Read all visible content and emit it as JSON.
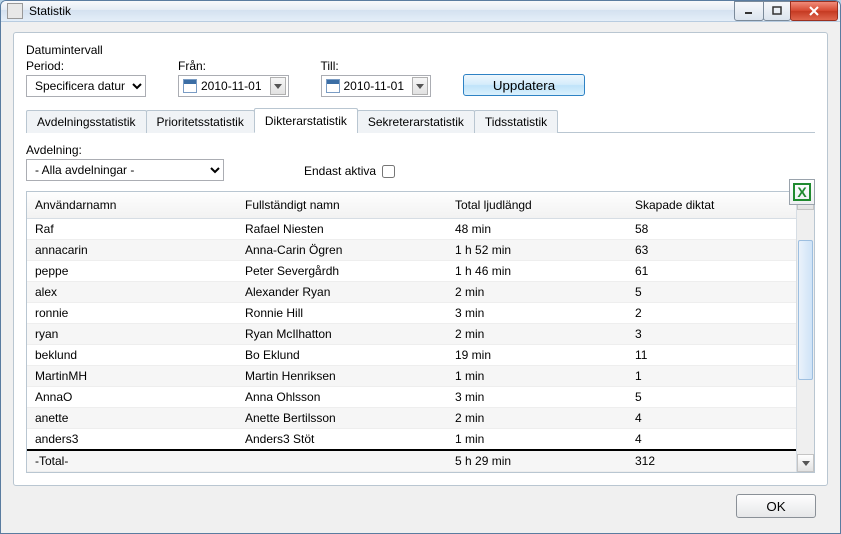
{
  "window": {
    "title": "Statistik"
  },
  "filters": {
    "section_label": "Datumintervall",
    "period_label": "Period:",
    "period_value": "Specificera datum",
    "from_label": "Från:",
    "from_value": "2010-11-01",
    "to_label": "Till:",
    "to_value": "2010-11-01",
    "update_label": "Uppdatera"
  },
  "tabs": [
    {
      "label": "Avdelningsstatistik",
      "active": false
    },
    {
      "label": "Prioritetsstatistik",
      "active": false
    },
    {
      "label": "Dikterarstatistik",
      "active": true
    },
    {
      "label": "Sekreterarstatistik",
      "active": false
    },
    {
      "label": "Tidsstatistik",
      "active": false
    }
  ],
  "subfilters": {
    "avdelning_label": "Avdelning:",
    "avdelning_value": "- Alla avdelningar -",
    "endast_aktiva_label": "Endast aktiva",
    "endast_aktiva_checked": false
  },
  "table": {
    "columns": [
      "Användarnamn",
      "Fullständigt namn",
      "Total ljudlängd",
      "Skapade diktat"
    ],
    "rows": [
      {
        "user": "Raf",
        "name": "Rafael Niesten",
        "length": "48 min",
        "count": "58"
      },
      {
        "user": "annacarin",
        "name": "Anna-Carin Ögren",
        "length": "1 h 52 min",
        "count": "63"
      },
      {
        "user": "peppe",
        "name": "Peter Severgårdh",
        "length": "1 h 46 min",
        "count": "61"
      },
      {
        "user": "alex",
        "name": "Alexander Ryan",
        "length": "2 min",
        "count": "5"
      },
      {
        "user": "ronnie",
        "name": "Ronnie Hill",
        "length": "3 min",
        "count": "2"
      },
      {
        "user": "ryan",
        "name": "Ryan McIlhatton",
        "length": "2 min",
        "count": "3"
      },
      {
        "user": "beklund",
        "name": "Bo Eklund",
        "length": "19 min",
        "count": "11"
      },
      {
        "user": "MartinMH",
        "name": "Martin Henriksen",
        "length": "1 min",
        "count": "1"
      },
      {
        "user": "AnnaO",
        "name": "Anna Ohlsson",
        "length": "3 min",
        "count": "5"
      },
      {
        "user": "anette",
        "name": "Anette Bertilsson",
        "length": "2 min",
        "count": "4"
      },
      {
        "user": "anders3",
        "name": "Anders3 Stöt",
        "length": "1 min",
        "count": "4"
      }
    ],
    "total": {
      "user": "-Total-",
      "name": "",
      "length": "5 h 29 min",
      "count": "312"
    }
  },
  "footer": {
    "ok_label": "OK"
  }
}
